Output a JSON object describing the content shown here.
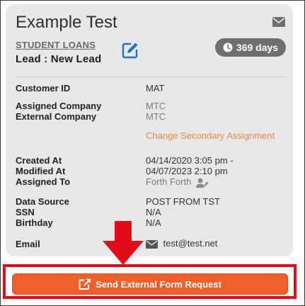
{
  "card": {
    "title": "Example Test",
    "category": "STUDENT LOANS",
    "lead": "Lead : New Lead",
    "days_badge": "369 days"
  },
  "fields": {
    "customer_id": {
      "label": "Customer ID",
      "value": "MAT"
    },
    "assigned_company": {
      "label": "Assigned Company",
      "value": "MTC"
    },
    "external_company": {
      "label": "External Company",
      "value": "MTC"
    },
    "change_secondary": "Change Secondary Assignment",
    "created_at": {
      "label": "Created At",
      "value": "04/14/2020 3:05 pm -"
    },
    "modified_at": {
      "label": "Modified At",
      "value": "04/07/2023 2:10 pm"
    },
    "assigned_to": {
      "label": "Assigned To",
      "value": "Forth Forth"
    },
    "data_source": {
      "label": "Data Source",
      "value": "POST FROM TST"
    },
    "ssn": {
      "label": "SSN",
      "value": "N/A"
    },
    "birthday": {
      "label": "Birthday",
      "value": "N/A"
    },
    "email": {
      "label": "Email",
      "value": "test@test.net"
    }
  },
  "action": {
    "button_label": "Send External Form Request"
  },
  "icons": {
    "mail": "envelope-icon",
    "edit": "edit-icon",
    "clock": "clock-icon",
    "user": "user-edit-icon",
    "external": "external-link-icon",
    "arrow": "arrow-down-icon"
  },
  "colors": {
    "card_bg": "#e8e8e8",
    "badge_bg": "#6f6f6f",
    "edit_blue": "#1a73c9",
    "link_orange": "#f0874a",
    "button_orange": "#f15f2a",
    "highlight_red": "#e10c18"
  }
}
